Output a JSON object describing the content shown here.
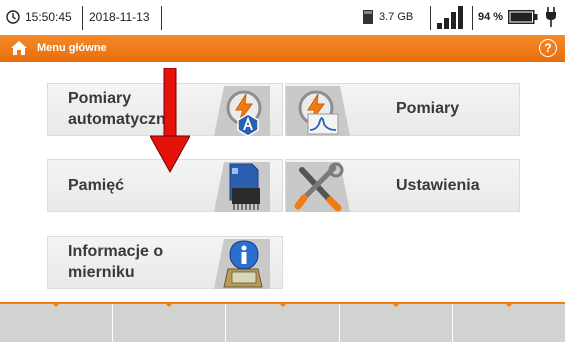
{
  "status": {
    "time": "15:50:45",
    "date": "2018-11-13",
    "storage": "3.7 GB",
    "battery": "94 %",
    "battery_level": 0.94
  },
  "header": {
    "title": "Menu główne",
    "help": "?"
  },
  "menu": {
    "pomiary_auto": {
      "line1": "Pomiary",
      "line2": "automatyczne"
    },
    "pomiary": {
      "label": "Pomiary"
    },
    "pamiec": {
      "label": "Pamięć"
    },
    "ustawienia": {
      "label": "Ustawienia"
    },
    "informacje": {
      "line1": "Informacje o",
      "line2": "mierniku"
    }
  },
  "colors": {
    "accent": "#f07c14",
    "arrow": "#e3120b"
  },
  "softkeys_count": 5
}
